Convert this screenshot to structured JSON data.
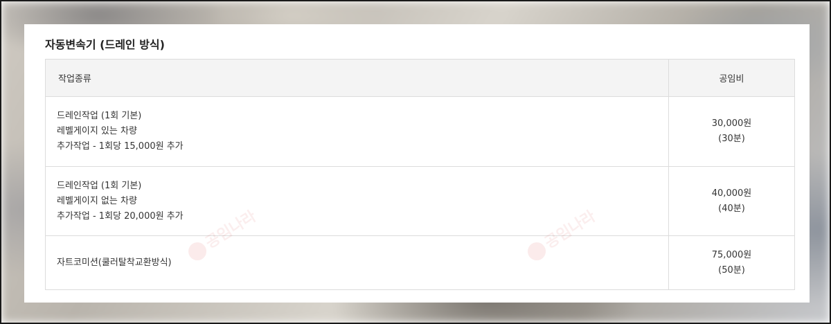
{
  "section_title": "자동변속기 (드레인 방식)",
  "table": {
    "headers": {
      "job_type": "작업종류",
      "labor_fee": "공임비"
    },
    "rows": [
      {
        "lines": [
          "드레인작업 (1회 기본)",
          "레벨게이지 있는 차량",
          "추가작업 - 1회당 15,000원 추가"
        ],
        "price": "30,000원",
        "duration": "(30분)"
      },
      {
        "lines": [
          "드레인작업 (1회 기본)",
          "레벨게이지 없는 차량",
          "추가작업 - 1회당 20,000원 추가"
        ],
        "price": "40,000원",
        "duration": "(40분)"
      },
      {
        "lines": [
          "자트코미션(쿨러탈착교환방식)"
        ],
        "price": "75,000원",
        "duration": "(50분)"
      }
    ]
  },
  "watermark_text": "공임나라",
  "colors": {
    "header_bg": "#f4f4f4",
    "border": "#dcdcdc",
    "panel_bg": "#ffffff",
    "watermark": "#dc5a5a"
  }
}
